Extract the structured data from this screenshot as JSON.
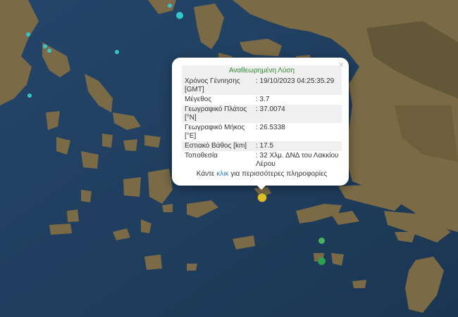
{
  "map": {
    "colors": {
      "sea": "#1f3d5a",
      "land": "#7a6a45",
      "land_dark": "#5c5233",
      "land_light": "#9a8a60"
    }
  },
  "popup": {
    "title": "Αναθεωρημένη Λύση",
    "close_label": "×",
    "rows": [
      {
        "label": "Χρόνος Γένnησης [GMT]",
        "value": ": 19/10/2023 04:25:35.29"
      },
      {
        "label": "Μέγεθος",
        "value": ": 3.7"
      },
      {
        "label": "Γεωγραφικό Πλάτος [°N]",
        "value": ": 37.0074"
      },
      {
        "label": "Γεωγραφικό Μήκος [°E]",
        "value": ": 26.5338"
      },
      {
        "label": "Εστιακό Βάθος [km]",
        "value": ": 17.5"
      },
      {
        "label": "Τοποθεσία",
        "value": ": 32 Χλμ. ΔΝΔ του Λακκίου Λέρου"
      }
    ],
    "footer_prefix": "Κάντε",
    "footer_link": "κλικ",
    "footer_suffix": "για περισσότερες πληροφορίες"
  },
  "markers": [
    {
      "id": "selected-quake",
      "color": "#e0c020",
      "magnitude": "3.7"
    },
    {
      "id": "quake-green-1",
      "color": "#2aa050"
    },
    {
      "id": "quake-green-2",
      "color": "#48b060"
    },
    {
      "id": "quake-cyan-1",
      "color": "#30c8c8"
    },
    {
      "id": "quake-cyan-2",
      "color": "#30c8c8"
    },
    {
      "id": "quake-cyan-3",
      "color": "#30c8c8"
    },
    {
      "id": "quake-cyan-4",
      "color": "#30c8c8"
    },
    {
      "id": "quake-cyan-5",
      "color": "#30c8c8"
    },
    {
      "id": "quake-cyan-6",
      "color": "#30c8c8"
    },
    {
      "id": "quake-cyan-7",
      "color": "#30c8c8"
    }
  ]
}
